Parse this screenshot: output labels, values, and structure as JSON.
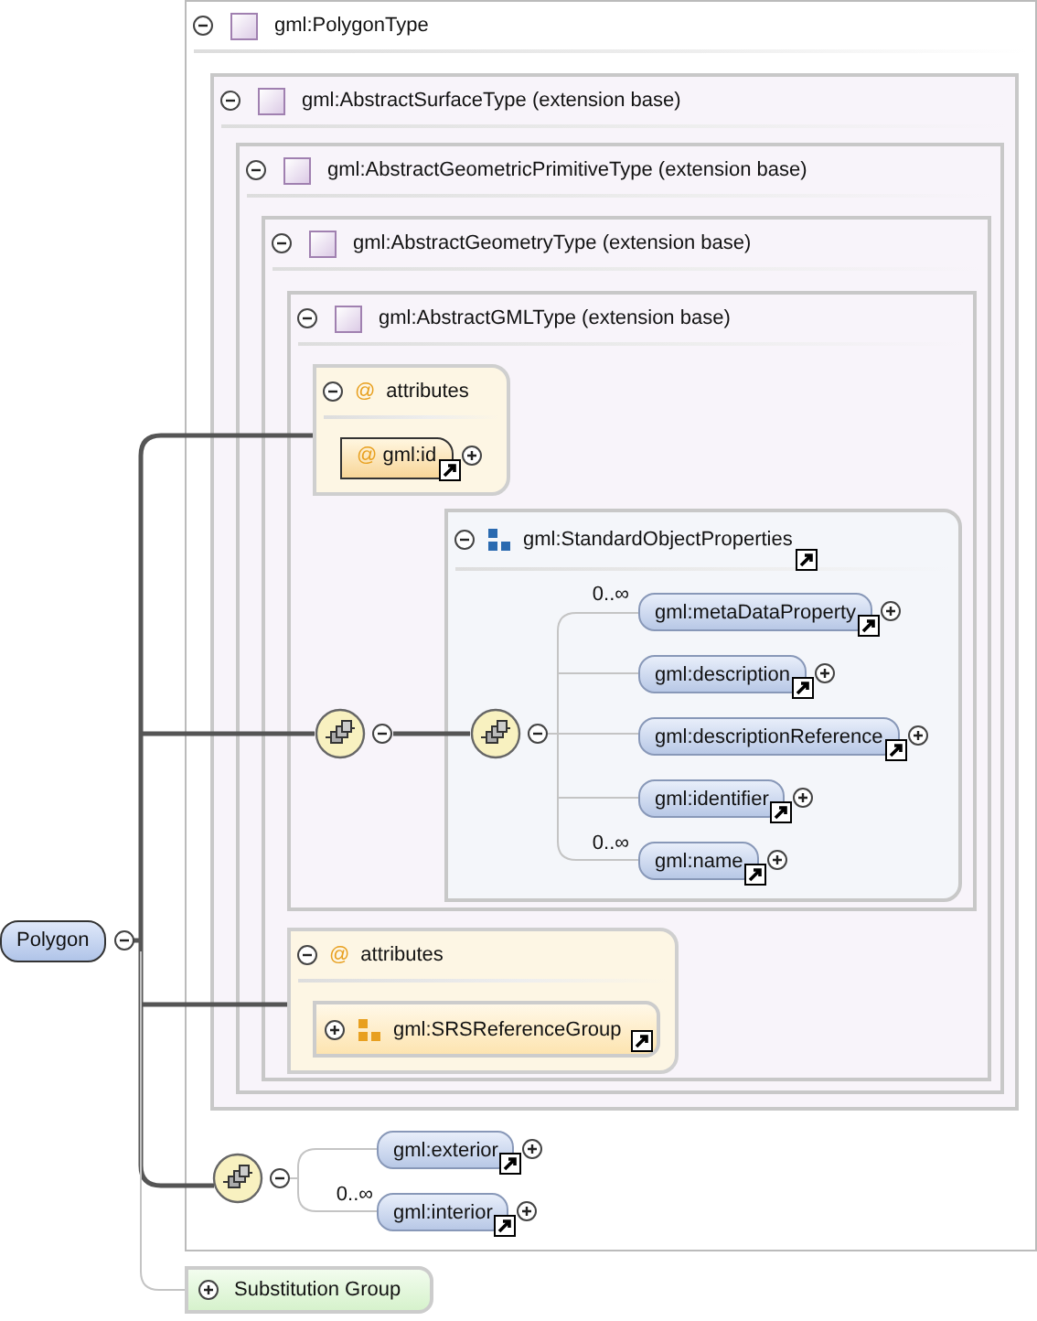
{
  "type_boxes": [
    {
      "label": "gml:PolygonType",
      "expanded": true
    },
    {
      "label": "gml:AbstractSurfaceType (extension base)",
      "expanded": true
    },
    {
      "label": "gml:AbstractGeometricPrimitiveType (extension base)",
      "expanded": true
    },
    {
      "label": "gml:AbstractGeometryType (extension base)",
      "expanded": true
    },
    {
      "label": "gml:AbstractGMLType (extension base)",
      "expanded": true
    }
  ],
  "attribute_boxes": [
    {
      "symbol": "@",
      "title": "attributes",
      "expanded": true,
      "item": {
        "kind": "attribute",
        "symbol": "@",
        "label": "gml:id",
        "expanded": false
      }
    },
    {
      "symbol": "@",
      "title": "attributes",
      "expanded": true,
      "item": {
        "kind": "attribute_group",
        "label": "gml:SRSReferenceGroup",
        "expanded": false
      }
    }
  ],
  "content_sequence": {
    "expanded": true
  },
  "group": {
    "label": "gml:StandardObjectProperties",
    "expanded": true,
    "sequence_expanded": true,
    "elements": [
      {
        "label": "gml:metaDataProperty",
        "cardinality": "0..∞",
        "expanded": false
      },
      {
        "label": "gml:description",
        "expanded": false
      },
      {
        "label": "gml:descriptionReference",
        "expanded": false
      },
      {
        "label": "gml:identifier",
        "expanded": false
      },
      {
        "label": "gml:name",
        "cardinality": "0..∞",
        "expanded": false
      }
    ]
  },
  "root": {
    "label": "Polygon",
    "expanded": true
  },
  "polygon_sequence": {
    "expanded": true,
    "elements": [
      {
        "label": "gml:exterior",
        "expanded": false
      },
      {
        "label": "gml:interior",
        "cardinality": "0..∞",
        "expanded": false
      }
    ]
  },
  "substitution_group": {
    "label": "Substitution Group",
    "expanded": false
  }
}
